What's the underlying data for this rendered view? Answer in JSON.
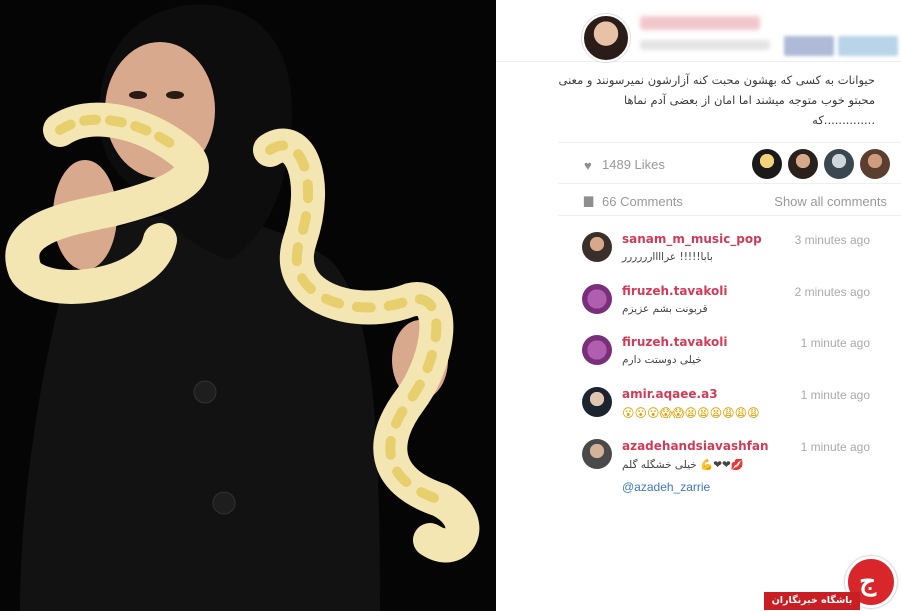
{
  "post": {
    "caption_lines": [
      "حیوانات به کسی که بهشون محبت کنه آزارشون نمیرسونند و معنی",
      "محبتو خوب متوجه میشند اما امان از بعضی آدم نماها",
      "..............که"
    ],
    "likes_label": "1489 Likes",
    "comments_label": "66 Comments",
    "show_all_label": "Show all comments"
  },
  "comments": [
    {
      "user": "sanam_m_music_pop",
      "time": "3 minutes ago",
      "text": "بابا!!!!! عراااارررررر"
    },
    {
      "user": "firuzeh.tavakoli",
      "time": "2 minutes ago",
      "text": "قربونت بشم عزیزم"
    },
    {
      "user": "firuzeh.tavakoli",
      "time": "1 minute ago",
      "text": "خیلی دوستت دارم"
    },
    {
      "user": "amir.aqaee.a3",
      "time": "1 minute ago",
      "text": "😮😮😮😱😱😫😫😫😩😩😩"
    },
    {
      "user": "azadehandsiavashfan",
      "time": "1 minute ago",
      "text": "💋❤❤💪 خیلی خشگله گلم",
      "mention": "@azadeh_zarrie"
    }
  ],
  "watermark": {
    "label": "باشگاه خبرنگاران",
    "glyph": "ج"
  },
  "icons": {
    "likes": "heart-icon",
    "comments": "comment-icon"
  },
  "colors": {
    "username": "#d23b57",
    "mention": "#3b78c4",
    "watermark": "#c81f25"
  }
}
